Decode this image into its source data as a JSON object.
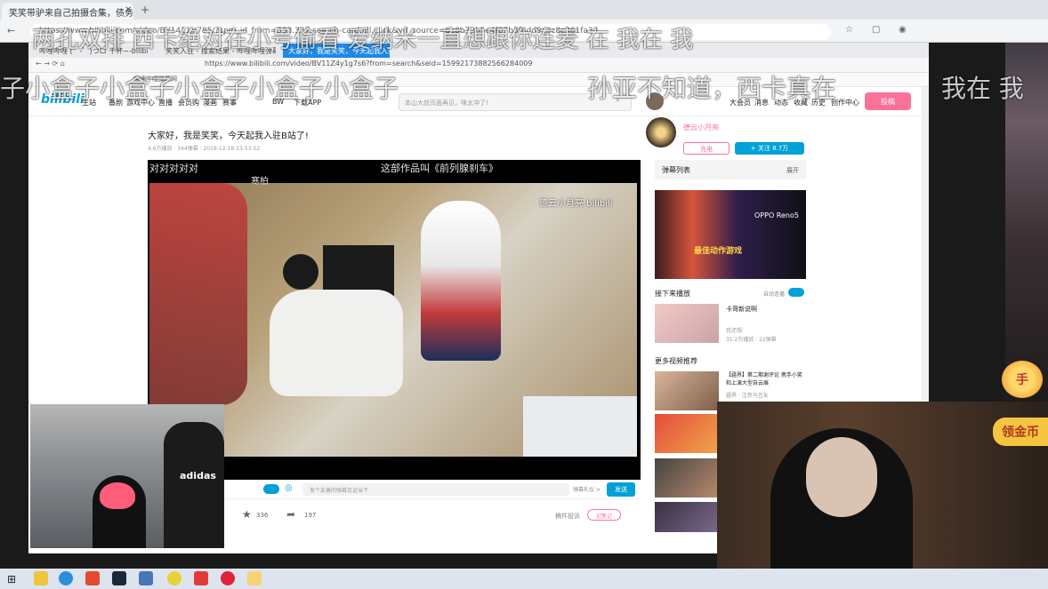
{
  "outer_browser": {
    "active_tab": "笑笑带驴来自己拍摄合集，债务...",
    "url": "https://www.bilibili.com/video/BV1411H785/?spm_id_from=333.337.search-card.all.click&vd_source=6c8b72b5e4f07b3f8dd9c3c8c361fa34"
  },
  "inner_browser": {
    "tabs": [
      "哔哩哔哩 (゜-゜)つロ 干杯~-bilibili",
      "笑笑入驻 - 搜索结果 - 哔哩哔哩弹幕",
      "大家好，我是笑笑，今天起我入驻..."
    ],
    "url": "https://www.bilibili.com/video/BV11Z4y1g7s6?from=search&seid=15992173882566284009",
    "bookmarks_label": "哔哩哔哩弹幕网"
  },
  "bili_nav": {
    "items": [
      "主站",
      "番剧",
      "游戏中心",
      "直播",
      "会员购",
      "漫画",
      "赛事",
      "BW",
      "下载APP"
    ],
    "search_placeholder": "本山大叔页面再见，咪太冲了!",
    "right_items": [
      "大会员",
      "消息",
      "动态",
      "收藏",
      "历史",
      "创作中心"
    ],
    "upload": "投稿"
  },
  "video": {
    "title": "大家好，我是笑笑，今天起我入驻B站了!",
    "meta": "4.6万播放 · 344弹幕 · 2019-12-18 23:53:52",
    "likes": "336",
    "shares": "197",
    "danmu_placeholder": "发个友善的弹幕见证当下",
    "danmu_etiquette": "弹幕礼仪 >",
    "send": "发送",
    "report": "稿件投诉",
    "note": "记笔记"
  },
  "frame_captions": {
    "top_left": "对对对对对",
    "top_center": "这部作品叫《前列腺刹车》",
    "watermark": "德云小月亮 bilibili",
    "mid_left": "寒柏"
  },
  "danmaku": {
    "line1": "两孔双排   西卡绝对在小号偷看   爱纳米一直想跟你连麦   在   我在 我",
    "line2": "子小盒子小盒子小盒子小盒子小盒子",
    "line3": "孙亚不知道，西卡真在",
    "line4": "我在 我"
  },
  "sidebar": {
    "up_name": "德云小月亮",
    "charge": "充电",
    "follow": "+ 关注 8.7万",
    "playlist": "弹幕列表",
    "expand": "展开",
    "ad_brand": "OPPO Reno5",
    "ad_title": "最佳动作游戏",
    "next_label": "接下来播放",
    "autoplay": "自动连播",
    "next_title": "卡哥新说啊",
    "next_up": "我还想",
    "next_stats": "31.2万播放 · 22弹幕",
    "more_label": "更多视频推荐",
    "rec1_title": "【疆界】第二期谢评论 携手小笑和上演大型自云展",
    "rec1_up": "疆界 · 注意马丑友"
  },
  "gift_button": "领金币",
  "gift_coin": "手"
}
